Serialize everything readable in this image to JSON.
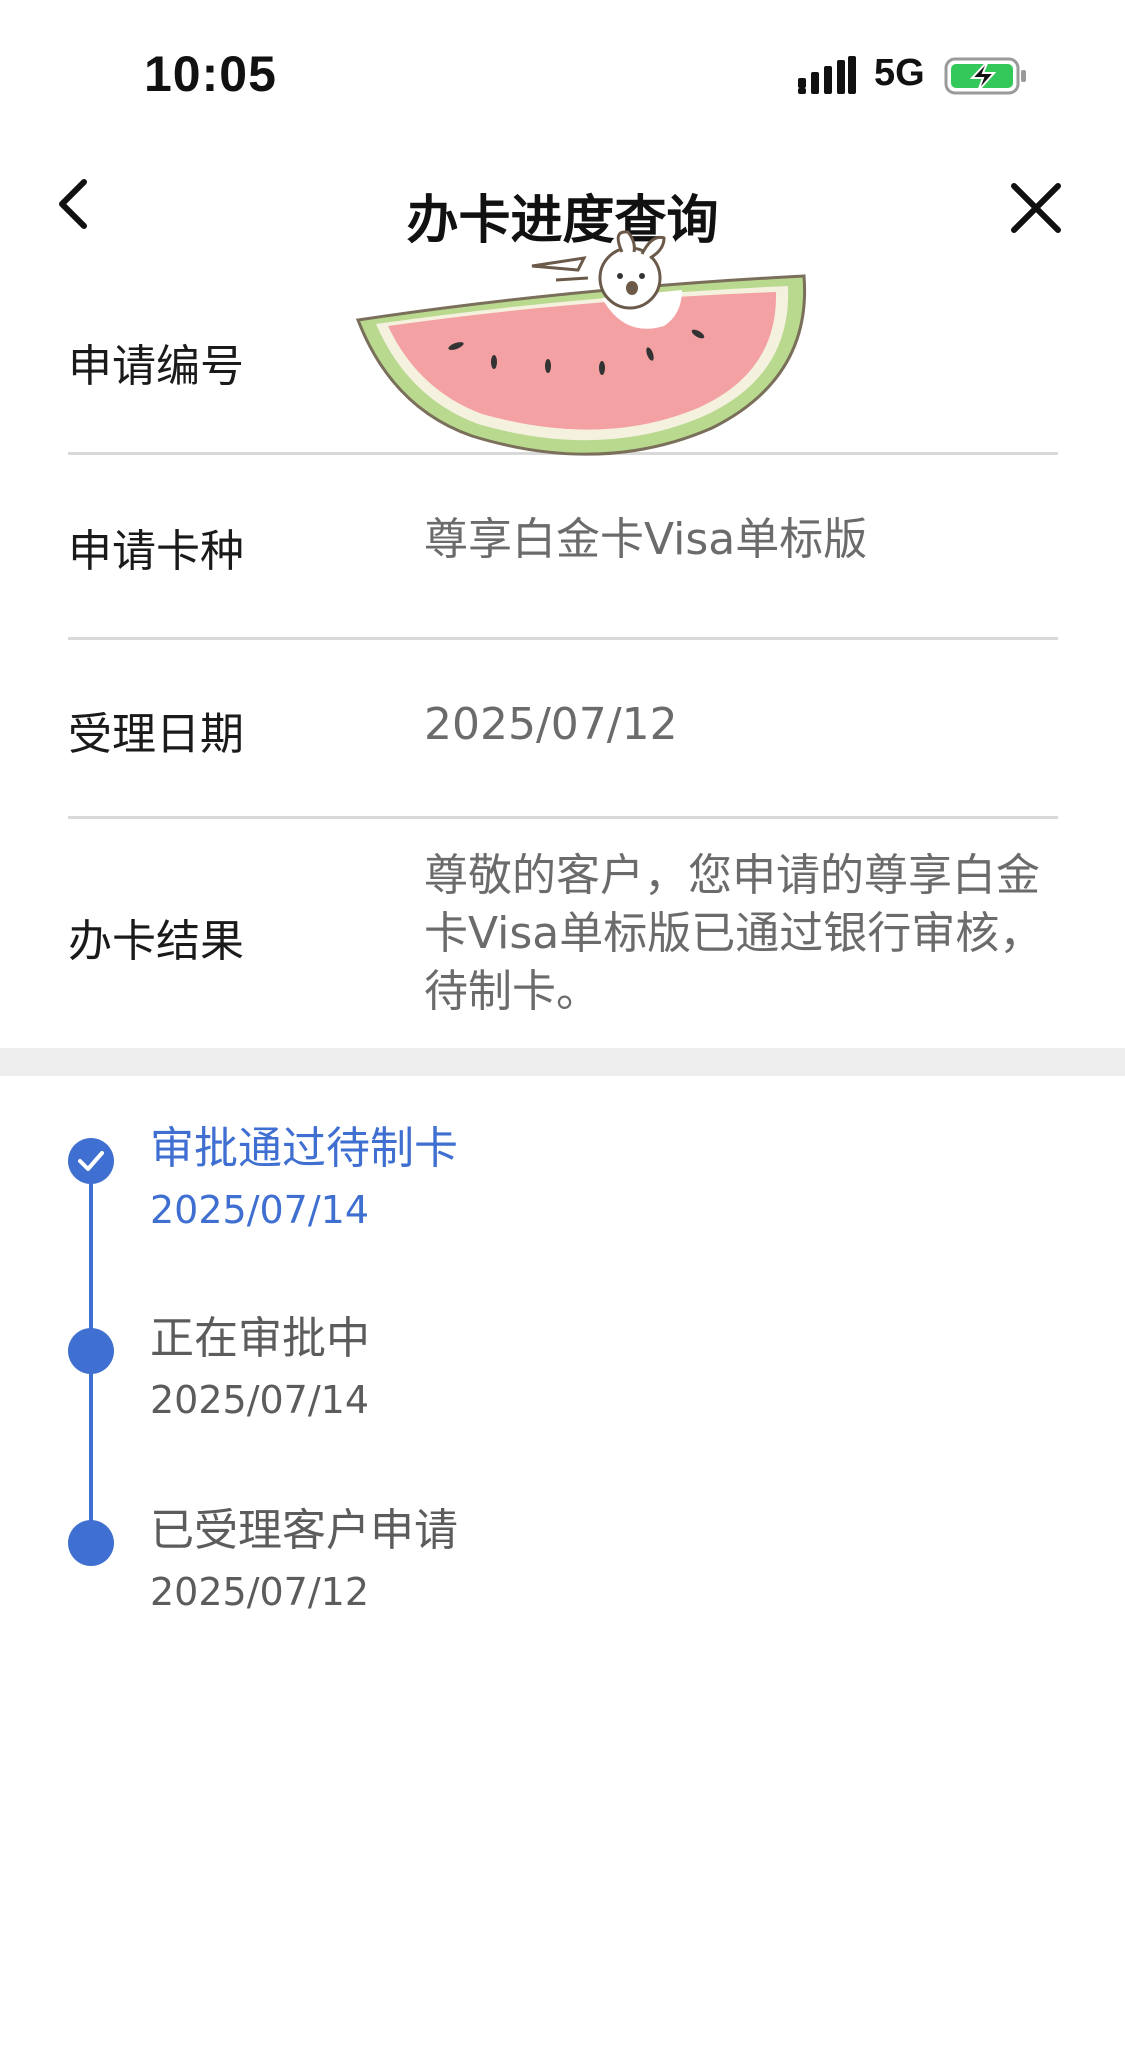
{
  "status_bar": {
    "time": "10:05",
    "network": "5G",
    "signal_icon": "signal-bars-icon",
    "battery_icon": "battery-charging-icon",
    "battery_color": "#34c759"
  },
  "nav": {
    "title": "办卡进度查询",
    "back_icon": "chevron-left-icon",
    "close_icon": "close-icon"
  },
  "info_rows": [
    {
      "label": "申请编号",
      "value": ""
    },
    {
      "label": "申请卡种",
      "value": "尊享白金卡Visa单标版"
    },
    {
      "label": "受理日期",
      "value": "2025/07/12"
    },
    {
      "label": "办卡结果",
      "value_lines": [
        "尊敬的客户，您申请的尊享白金",
        "卡Visa单标版已通过银行审核，",
        "待制卡。"
      ]
    }
  ],
  "timeline": [
    {
      "title": "审批通过待制卡",
      "date": "2025/07/14",
      "status": "current"
    },
    {
      "title": "正在审批中",
      "date": "2025/07/14",
      "status": "done"
    },
    {
      "title": "已受理客户申请",
      "date": "2025/07/12",
      "status": "done"
    }
  ],
  "colors": {
    "accent": "#3f6fd0",
    "label": "#1a1a1a",
    "value": "#6b6b6b",
    "divider": "#d9d9d9",
    "band": "#eeeeee"
  }
}
